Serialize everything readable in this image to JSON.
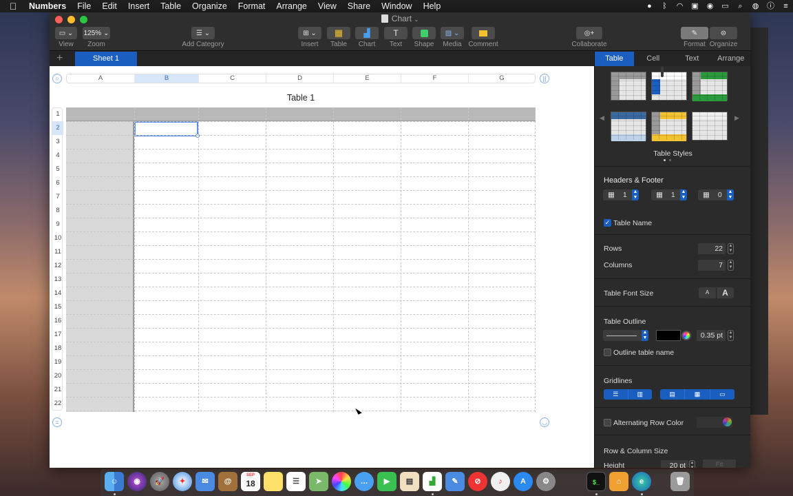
{
  "menubar": {
    "app": "Numbers",
    "items": [
      "File",
      "Edit",
      "Insert",
      "Table",
      "Organize",
      "Format",
      "Arrange",
      "View",
      "Share",
      "Window",
      "Help"
    ],
    "status_icons": [
      "record-icon",
      "bluetooth-icon",
      "wifi-icon",
      "screenshare-icon",
      "vpn-icon",
      "battery-icon",
      "search-icon",
      "siri-icon",
      "info-icon",
      "list-icon"
    ]
  },
  "window": {
    "title": "Chart",
    "toolbar": {
      "view": "View",
      "zoom_value": "125%",
      "zoom": "Zoom",
      "add_category": "Add Category",
      "insert": "Insert",
      "table": "Table",
      "chart": "Chart",
      "text": "Text",
      "shape": "Shape",
      "media": "Media",
      "comment": "Comment",
      "collaborate": "Collaborate",
      "format": "Format",
      "organize": "Organize"
    },
    "sheet_tab": "Sheet 1",
    "add_sheet": "+"
  },
  "table": {
    "name": "Table 1",
    "columns": [
      "A",
      "B",
      "C",
      "D",
      "E",
      "F",
      "G"
    ],
    "selected_column": "B",
    "rows": [
      "1",
      "2",
      "3",
      "4",
      "5",
      "6",
      "7",
      "8",
      "9",
      "10",
      "11",
      "12",
      "13",
      "14",
      "15",
      "16",
      "17",
      "18",
      "19",
      "20",
      "21",
      "22"
    ],
    "selected_row": "2"
  },
  "inspector": {
    "tabs": [
      "Table",
      "Cell",
      "Text",
      "Arrange"
    ],
    "active_tab": "Table",
    "table_styles_label": "Table Styles",
    "headers_footer": {
      "title": "Headers & Footer",
      "header_rows": "1",
      "header_columns": "1",
      "footer_rows": "0"
    },
    "table_name_label": "Table Name",
    "table_name_checked": true,
    "rows_label": "Rows",
    "rows_value": "22",
    "columns_label": "Columns",
    "columns_value": "7",
    "font_size_label": "Table Font Size",
    "font_small": "A",
    "font_large": "A",
    "outline": {
      "title": "Table Outline",
      "width": "0.35 pt",
      "color": "#000000",
      "outline_name_label": "Outline table name"
    },
    "gridlines_label": "Gridlines",
    "alternating_label": "Alternating Row Color",
    "row_col_size_label": "Row & Column Size",
    "height_label": "Height",
    "height_value": "20 pt",
    "fit_label": "Fit"
  },
  "dock": {
    "apps": [
      "finder",
      "siri",
      "launchpad",
      "safari",
      "mail",
      "contacts",
      "calendar",
      "notes",
      "reminders",
      "maps",
      "photos",
      "messages",
      "facetime",
      "keynote",
      "numbers",
      "pages",
      "news",
      "music",
      "app-store",
      "system-preferences",
      "terminal",
      "home",
      "edge",
      "trash"
    ],
    "calendar_month": "SEP",
    "calendar_day": "18"
  },
  "colors": {
    "accent": "#1a5fc0",
    "menubar": "#1f1f1f",
    "header_fill": "#b9b9b9"
  }
}
